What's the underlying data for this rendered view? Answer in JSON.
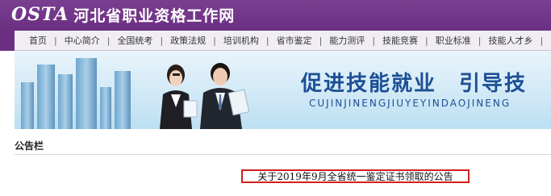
{
  "site": {
    "logo_text": "OSTA",
    "title": "河北省职业资格工作网"
  },
  "nav": {
    "items": [
      "首页",
      "中心简介",
      "全国统考",
      "政策法规",
      "培训机构",
      "省市鉴定",
      "能力测评",
      "技能竞赛",
      "职业标准",
      "技能人才乡"
    ],
    "separator": "|"
  },
  "banner": {
    "slogan": "促进技能就业　引导技",
    "pinyin": "CUJINJINENGJIUYEYINDAOJINENG"
  },
  "section": {
    "title": "公告栏"
  },
  "notice": {
    "link_text": "关于2019年9月全省统一鉴定证书领取的公告"
  },
  "colors": {
    "header_purple": "#6b2f82",
    "nav_bg": "#f1eef3",
    "highlight_border": "#d21f1f",
    "slogan_blue": "#1d4f95"
  }
}
